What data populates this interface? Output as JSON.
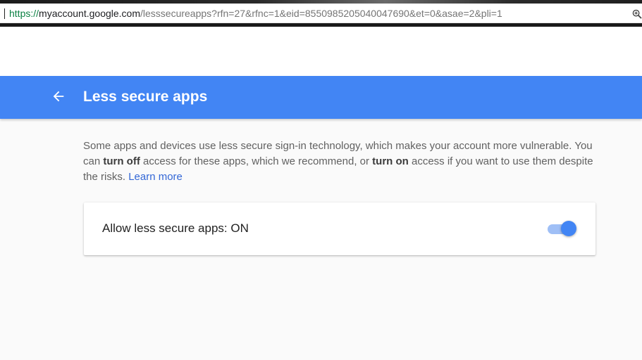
{
  "browser": {
    "url_scheme": "https://",
    "url_host": "myaccount.google.com",
    "url_rest": "/lesssecureapps?rfn=27&rfnc=1&eid=8550985205040047690&et=0&asae=2&pli=1",
    "zoom_icon": "zoom-magnifier-icon"
  },
  "header": {
    "back_icon": "arrow-back-icon",
    "title": "Less secure apps"
  },
  "content": {
    "desc_part1": "Some apps and devices use less secure sign-in technology, which makes your account more vulnerable. You can ",
    "desc_bold1": "turn off",
    "desc_part2": " access for these apps, which we recommend, or ",
    "desc_bold2": "turn on",
    "desc_part3": " access if you want to use them despite the risks. ",
    "learn_more": "Learn more"
  },
  "setting": {
    "label": "Allow less secure apps: ON",
    "enabled": true
  },
  "colors": {
    "accent": "#4285f4",
    "toggle_track": "#9fbff6",
    "link": "#3367d6",
    "url_scheme": "#0b8043"
  }
}
